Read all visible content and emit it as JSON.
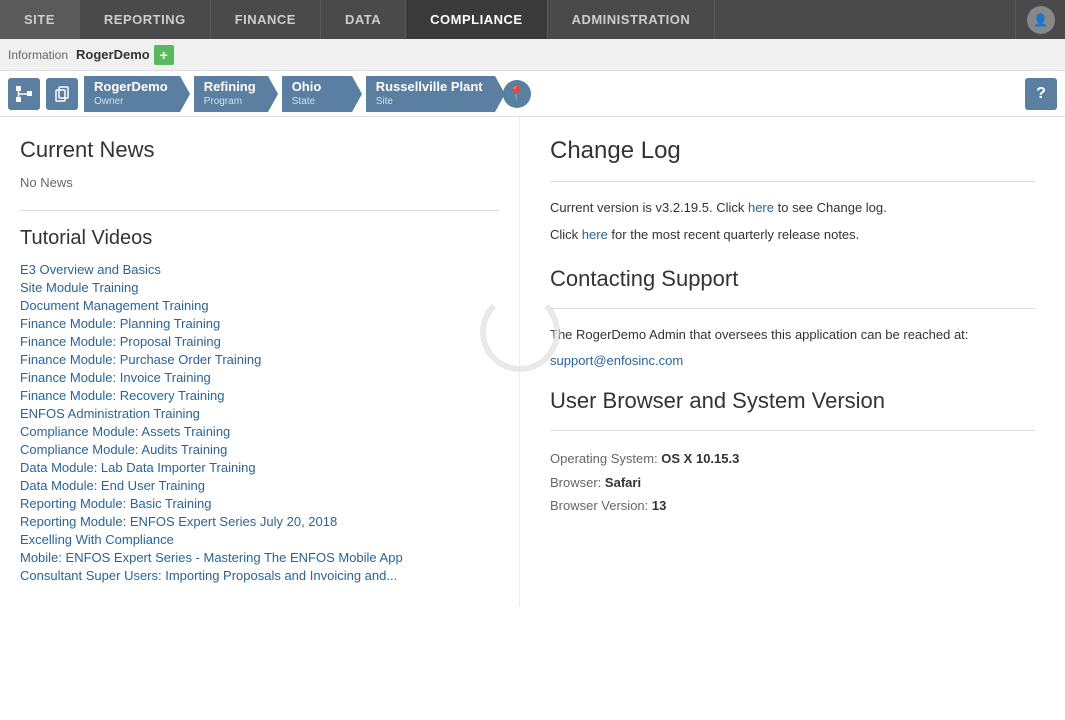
{
  "nav": {
    "items": [
      {
        "id": "site",
        "label": "SITE",
        "active": false
      },
      {
        "id": "reporting",
        "label": "REPORTING",
        "active": false
      },
      {
        "id": "finance",
        "label": "FINANCE",
        "active": false
      },
      {
        "id": "data",
        "label": "DATA",
        "active": false
      },
      {
        "id": "compliance",
        "label": "COMPLIANCE",
        "active": true
      },
      {
        "id": "administration",
        "label": "ADMINISTRATION",
        "active": false
      }
    ]
  },
  "infobar": {
    "label": "Information",
    "user": "RogerDemo"
  },
  "breadcrumb": {
    "items": [
      {
        "id": "rogerdemo",
        "name": "RogerDemo",
        "sub": "Owner"
      },
      {
        "id": "refining",
        "name": "Refining",
        "sub": "Program"
      },
      {
        "id": "ohio",
        "name": "Ohio",
        "sub": "State"
      },
      {
        "id": "russellville",
        "name": "Russellville Plant",
        "sub": "Site"
      }
    ]
  },
  "news": {
    "title": "Current News",
    "no_news_text": "No News"
  },
  "tutorials": {
    "title": "Tutorial Videos",
    "items": [
      "E3 Overview and Basics",
      "Site Module Training",
      "Document Management Training",
      "Finance Module: Planning Training",
      "Finance Module: Proposal Training",
      "Finance Module: Purchase Order Training",
      "Finance Module: Invoice Training",
      "Finance Module: Recovery Training",
      "ENFOS Administration Training",
      "Compliance Module: Assets Training",
      "Compliance Module: Audits Training",
      "Data Module: Lab Data Importer Training",
      "Data Module: End User Training",
      "Reporting Module: Basic Training",
      "Reporting Module: ENFOS Expert Series July 20, 2018",
      "Excelling With Compliance",
      "Mobile: ENFOS Expert Series - Mastering The ENFOS Mobile App",
      "Consultant Super Users: Importing Proposals and Invoicing and..."
    ]
  },
  "changelog": {
    "title": "Change Log",
    "version_text": "Current version is v3.2.19.5. Click ",
    "here_link1": "here",
    "version_text2": " to see Change log.",
    "quarterly_text": "Click ",
    "here_link2": "here",
    "quarterly_text2": " for the most recent quarterly release notes."
  },
  "support": {
    "title": "Contacting Support",
    "text": "The RogerDemo Admin that oversees this application can be reached at:",
    "email": "support@enfosinc.com"
  },
  "browser": {
    "title": "User Browser and System Version",
    "os_label": "Operating System:",
    "os_value": "OS X 10.15.3",
    "browser_label": "Browser:",
    "browser_value": "Safari",
    "version_label": "Browser Version:",
    "version_value": "13"
  }
}
